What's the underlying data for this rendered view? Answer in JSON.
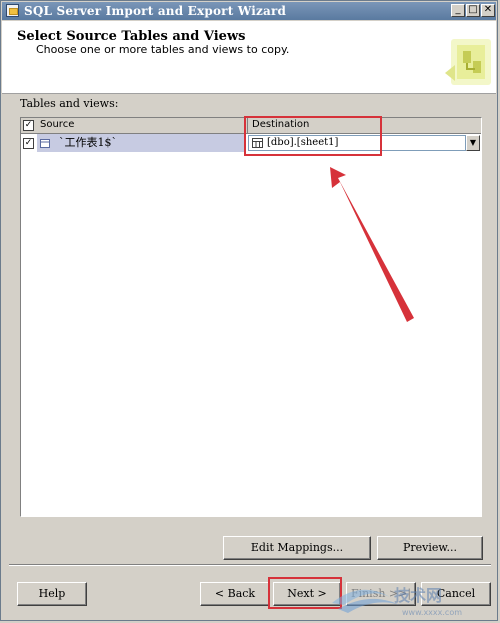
{
  "window": {
    "title": "SQL Server Import and Export Wizard",
    "controls": {
      "minimize": "_",
      "maximize": "□",
      "close": "✕"
    }
  },
  "header": {
    "title": "Select Source Tables and Views",
    "subtitle": "Choose one or more tables and views to copy."
  },
  "grid": {
    "label": "Tables and views:",
    "columns": {
      "source": "Source",
      "destination": "Destination"
    },
    "rows": [
      {
        "checked": true,
        "source": "`工作表1$`",
        "destination": "[dbo].[sheet1]"
      }
    ]
  },
  "buttons": {
    "edit_mappings": "Edit Mappings...",
    "preview": "Preview...",
    "help": "Help",
    "back": "< Back",
    "next": "Next >",
    "finish": "Finish >>|",
    "cancel": "Cancel"
  },
  "annotation": {
    "color": "#d6323a"
  },
  "watermark": {
    "text": "技术网",
    "subtext": "www.xxxx.com"
  }
}
